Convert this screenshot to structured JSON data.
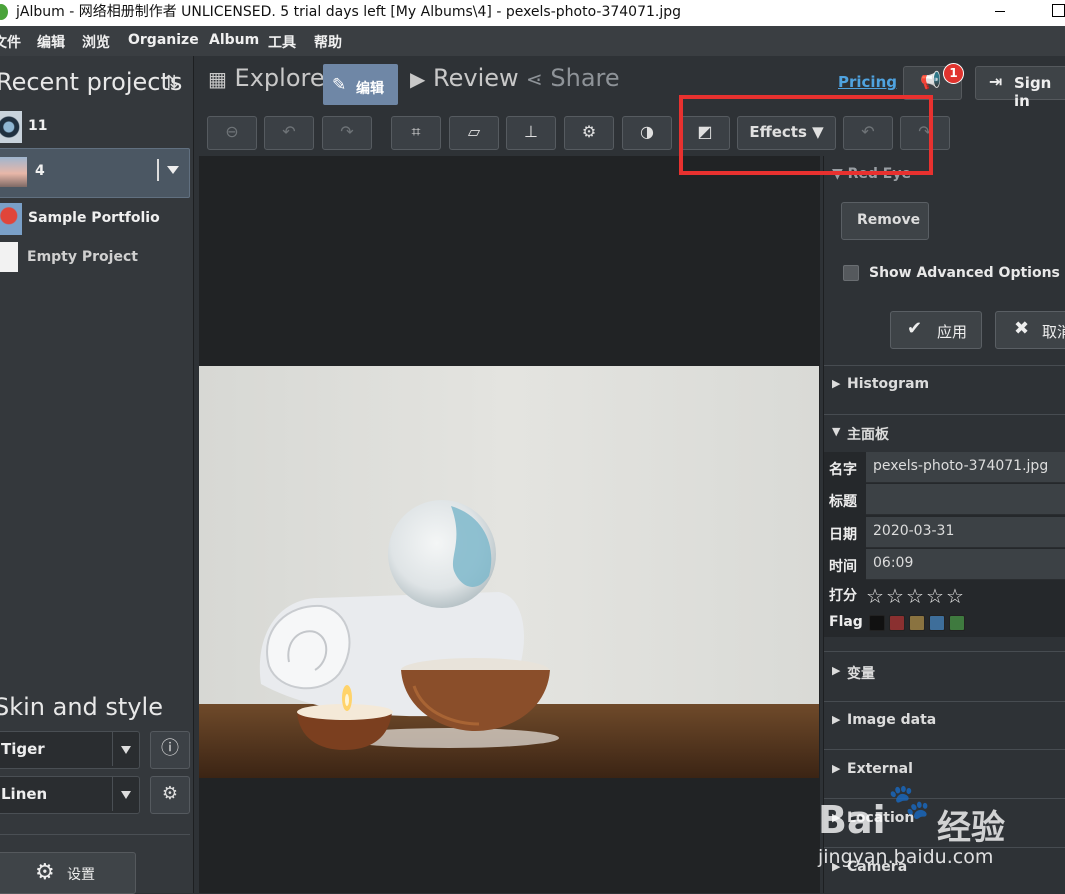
{
  "window": {
    "title": "jAlbum - 网络相册制作者 UNLICENSED. 5 trial days left [My Albums\\4] - pexels-photo-374071.jpg"
  },
  "menu": [
    "文件",
    "编辑",
    "浏览",
    "Organize",
    "Album",
    "工具",
    "帮助"
  ],
  "left_panel": {
    "recent_title": "Recent projects",
    "projects": [
      {
        "label": "11",
        "selected": false
      },
      {
        "label": "4",
        "selected": true
      },
      {
        "label": "Sample Portfolio",
        "selected": false
      },
      {
        "label": "Empty Project",
        "selected": false
      }
    ],
    "skin_title": "Skin and style",
    "skin_value": "Tiger",
    "style_value": "Linen",
    "settings_label": "设置"
  },
  "tabs": {
    "explore": "Explore",
    "edit": "编辑",
    "review": "Review",
    "share": "Share"
  },
  "header": {
    "pricing": "Pricing",
    "notification_count": "1",
    "sign_in": "Sign in"
  },
  "toolbar": {
    "effects": "Effects"
  },
  "right_panel": {
    "red_eye_title": "Red Eye",
    "remove_label": "Remove",
    "advanced_label": "Show Advanced Options",
    "apply_label": "应用",
    "cancel_label": "取消",
    "sections": {
      "histogram": "Histogram",
      "main_panel": "主面板",
      "variables": "变量",
      "image_data": "Image data",
      "external": "External",
      "location": "Location",
      "camera": "Camera"
    },
    "props": {
      "name_label": "名字",
      "name_value": "pexels-photo-374071.jpg",
      "title_label": "标题",
      "title_value": "",
      "date_label": "日期",
      "date_value": "2020-03-31",
      "time_label": "时间",
      "time_value": "06:09",
      "rating_label": "打分",
      "rating_stars": 0,
      "flag_label": "Flag"
    },
    "flag_colors": [
      "#111111",
      "#8a3030",
      "#8a7340",
      "#3e6e9a",
      "#3f7a3f"
    ]
  },
  "watermark": {
    "logo": "Bai",
    "logo_cn": "经验",
    "url": "jingyan.baidu.com"
  }
}
